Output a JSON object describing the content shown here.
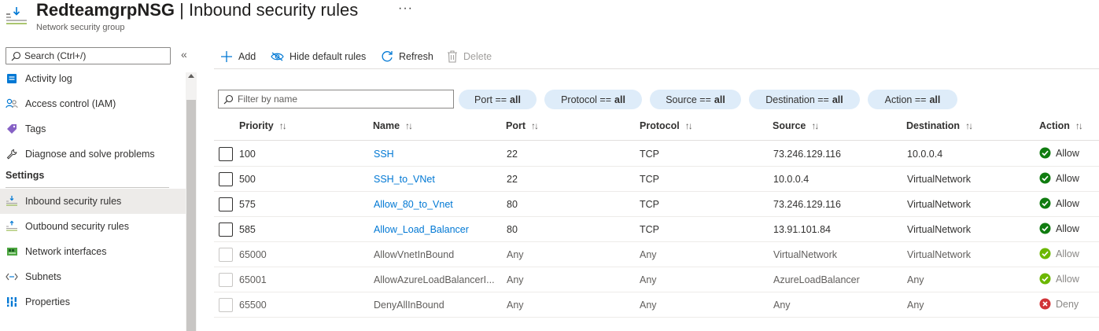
{
  "header": {
    "title_bold": "RedteamgrpNSG",
    "title_rest": " | Inbound security rules",
    "more": "···",
    "subtitle": "Network security group"
  },
  "sidebar": {
    "search_placeholder": "Search (Ctrl+/)",
    "collapse": "«",
    "items": [
      {
        "label": "Activity log",
        "icon": "activity-log-icon"
      },
      {
        "label": "Access control (IAM)",
        "icon": "people-icon"
      },
      {
        "label": "Tags",
        "icon": "tag-icon"
      },
      {
        "label": "Diagnose and solve problems",
        "icon": "wrench-icon"
      },
      {
        "label": "Inbound security rules",
        "icon": "inbound-rules-icon",
        "active": true
      },
      {
        "label": "Outbound security rules",
        "icon": "outbound-rules-icon"
      },
      {
        "label": "Network interfaces",
        "icon": "network-interface-icon"
      },
      {
        "label": "Subnets",
        "icon": "subnet-icon"
      },
      {
        "label": "Properties",
        "icon": "properties-icon"
      }
    ],
    "section_settings": "Settings"
  },
  "toolbar": {
    "add": "Add",
    "hide_default": "Hide default rules",
    "refresh": "Refresh",
    "delete": "Delete"
  },
  "filters": {
    "placeholder": "Filter by name",
    "pills": [
      {
        "label": "Port ==",
        "value": "all"
      },
      {
        "label": "Protocol ==",
        "value": "all"
      },
      {
        "label": "Source ==",
        "value": "all"
      },
      {
        "label": "Destination ==",
        "value": "all"
      },
      {
        "label": "Action ==",
        "value": "all"
      }
    ]
  },
  "table": {
    "columns": [
      "Priority",
      "Name",
      "Port",
      "Protocol",
      "Source",
      "Destination",
      "Action"
    ],
    "sort_glyph": "↑↓",
    "rows": [
      {
        "priority": "100",
        "name": "SSH",
        "port": "22",
        "protocol": "TCP",
        "source": "73.246.129.116",
        "destination": "10.0.0.4",
        "action": "Allow",
        "default": false
      },
      {
        "priority": "500",
        "name": "SSH_to_VNet",
        "port": "22",
        "protocol": "TCP",
        "source": "10.0.0.4",
        "destination": "VirtualNetwork",
        "action": "Allow",
        "default": false
      },
      {
        "priority": "575",
        "name": "Allow_80_to_Vnet",
        "port": "80",
        "protocol": "TCP",
        "source": "73.246.129.116",
        "destination": "VirtualNetwork",
        "action": "Allow",
        "default": false
      },
      {
        "priority": "585",
        "name": "Allow_Load_Balancer",
        "port": "80",
        "protocol": "TCP",
        "source": "13.91.101.84",
        "destination": "VirtualNetwork",
        "action": "Allow",
        "default": false
      },
      {
        "priority": "65000",
        "name": "AllowVnetInBound",
        "port": "Any",
        "protocol": "Any",
        "source": "VirtualNetwork",
        "destination": "VirtualNetwork",
        "action": "Allow",
        "default": true
      },
      {
        "priority": "65001",
        "name": "AllowAzureLoadBalancerI...",
        "port": "Any",
        "protocol": "Any",
        "source": "AzureLoadBalancer",
        "destination": "Any",
        "action": "Allow",
        "default": true
      },
      {
        "priority": "65500",
        "name": "DenyAllInBound",
        "port": "Any",
        "protocol": "Any",
        "source": "Any",
        "destination": "Any",
        "action": "Deny",
        "default": true
      }
    ]
  },
  "colors": {
    "link": "#0078d4",
    "allow": "#107c10",
    "allow_default": "#6bb700",
    "deny": "#d13438",
    "pill_bg": "#deecf9"
  }
}
